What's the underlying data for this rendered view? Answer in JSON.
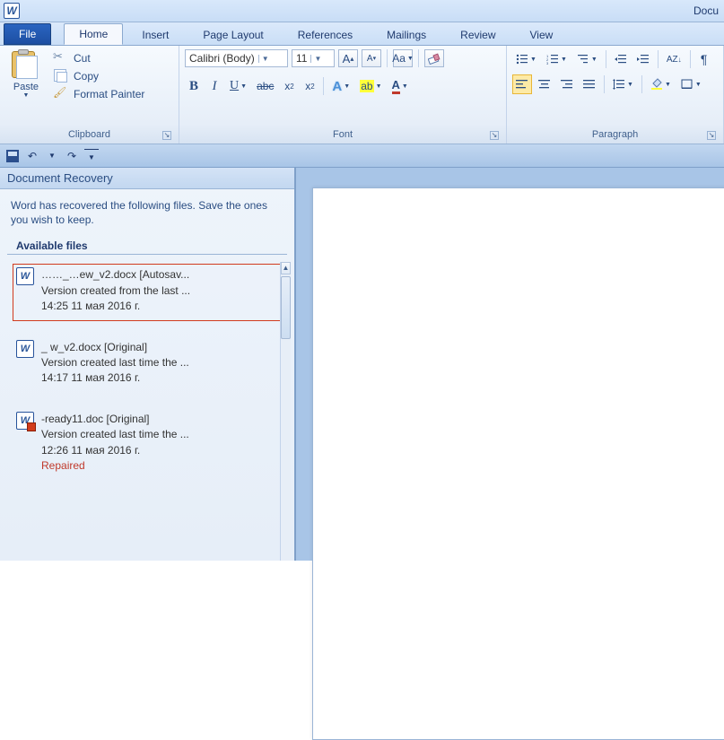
{
  "titlebar": {
    "title_fragment": "Docu"
  },
  "tabs": {
    "file": "File",
    "items": [
      "Home",
      "Insert",
      "Page Layout",
      "References",
      "Mailings",
      "Review",
      "View"
    ],
    "active_index": 0
  },
  "ribbon": {
    "clipboard": {
      "label": "Clipboard",
      "paste": "Paste",
      "cut": "Cut",
      "copy": "Copy",
      "format_painter": "Format Painter"
    },
    "font": {
      "label": "Font",
      "family": "Calibri (Body)",
      "size": "11"
    },
    "paragraph": {
      "label": "Paragraph"
    }
  },
  "recovery": {
    "title": "Document Recovery",
    "message": "Word has recovered the following files.  Save the ones you wish to keep.",
    "available_label": "Available files",
    "files": [
      {
        "name": "……_…ew_v2.docx  [Autosav...",
        "desc": "Version created from the last ...",
        "time": "14:25 11 мая 2016 г.",
        "status": ""
      },
      {
        "name": "   _   w_v2.docx  [Original]",
        "desc": "Version created last time the ...",
        "time": "14:17 11 мая 2016 г.",
        "status": ""
      },
      {
        "name": "-ready11.doc  [Original]",
        "desc": "Version created last time the ...",
        "time": "12:26 11 мая 2016 г.",
        "status": "Repaired"
      }
    ]
  }
}
